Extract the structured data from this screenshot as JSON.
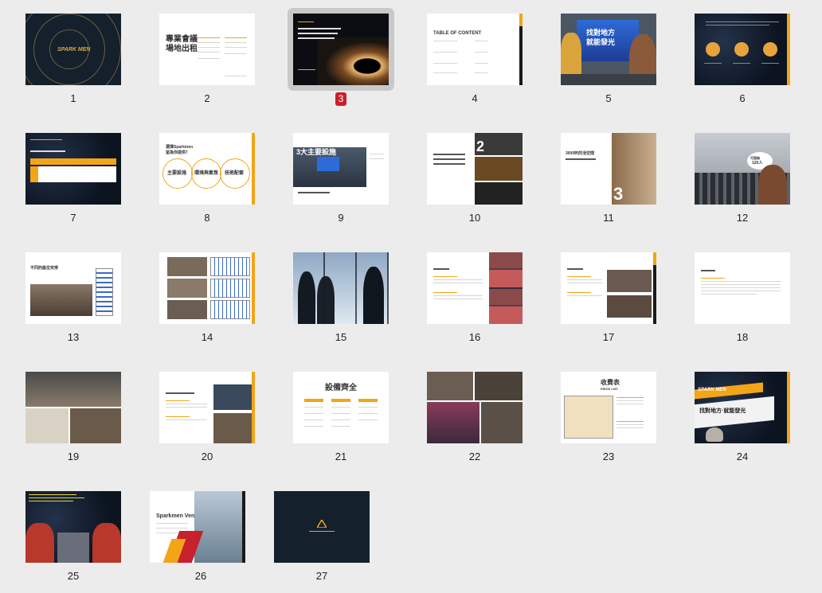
{
  "slides": [
    {
      "number": "1"
    },
    {
      "number": "2"
    },
    {
      "number": "3"
    },
    {
      "number": "4"
    },
    {
      "number": "5"
    },
    {
      "number": "6"
    },
    {
      "number": "7"
    },
    {
      "number": "8"
    },
    {
      "number": "9"
    },
    {
      "number": "10"
    },
    {
      "number": "11"
    },
    {
      "number": "12"
    },
    {
      "number": "13"
    },
    {
      "number": "14"
    },
    {
      "number": "15"
    },
    {
      "number": "16"
    },
    {
      "number": "17"
    },
    {
      "number": "18"
    },
    {
      "number": "19"
    },
    {
      "number": "20"
    },
    {
      "number": "21"
    },
    {
      "number": "22"
    },
    {
      "number": "23"
    },
    {
      "number": "24"
    },
    {
      "number": "25"
    },
    {
      "number": "26"
    },
    {
      "number": "27"
    }
  ],
  "selected_slide": "3",
  "thumb_text": {
    "s1_logo": "SPARK MEN",
    "s2_title_1": "專業會議",
    "s2_title_2": "場地出租",
    "s4_title": "TABLE OF CONTENT",
    "s5_sign_1": "找對地方",
    "s5_sign_2": "就能發光",
    "s8_title_1": "選擇Sparkmen",
    "s8_title_2": "室為你提供？",
    "s8_c1": "主要設施",
    "s8_c2": "環境與氣氛",
    "s8_c3": "技術配套",
    "s9_title": "3大主要設施",
    "s10_num": "2",
    "s11_num": "3",
    "s11_text": "3000呎的活空間",
    "s12_bubble_1": "可容納",
    "s12_bubble_2": "120人",
    "s13_title": "不同的座位安排",
    "s21_title": "設備齊全",
    "s23_title": "收費表",
    "s23_sub": "PRICE LIST",
    "s24_logo": "SPARK MEN",
    "s24_sign": "找對地方·就能發光",
    "s26_title": "Sparkmen Venue"
  },
  "colors": {
    "accent": "#f2a516",
    "selected_badge": "#c8202c",
    "background": "#ececec"
  }
}
